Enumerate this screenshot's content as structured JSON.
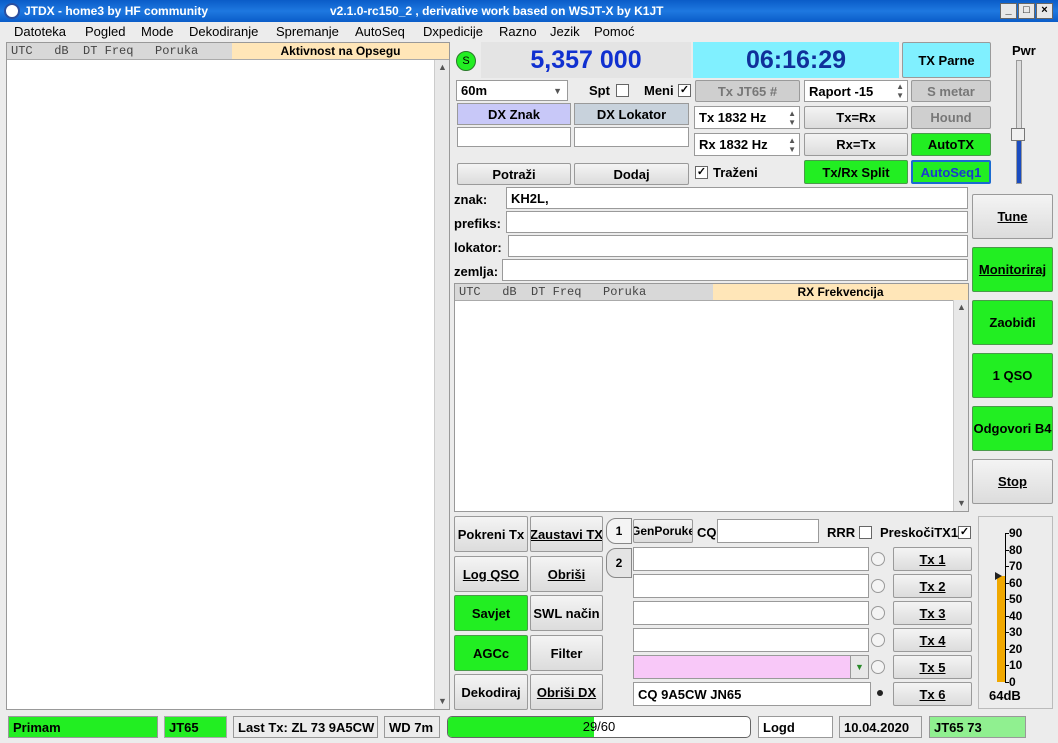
{
  "window": {
    "title_left": "JTDX - home3  by HF community",
    "title_right": "v2.1.0-rc150_2 , derivative work based on WSJT-X by K1JT",
    "min": "_",
    "max": "□",
    "close": "×"
  },
  "menu": [
    "Datoteka",
    "Pogled",
    "Mode",
    "Dekodiranje",
    "Spremanje",
    "AutoSeq",
    "Dxpedicije",
    "Razno",
    "Jezik",
    "Pomoć"
  ],
  "band_activity": {
    "header_cols": "UTC   dB  DT Freq   Poruka",
    "header_title": "Aktivnost na Opsegu"
  },
  "rx_frequency": {
    "header_cols": "UTC   dB  DT Freq   Poruka",
    "header_title": "RX Frekvencija"
  },
  "top": {
    "s_badge": "S",
    "frequency": "5,357 000",
    "clock": "06:16:29",
    "tx_parity": "TX Parne",
    "pwr_label": "Pwr",
    "band": "60m",
    "spt_label": "Spt",
    "meni_label": "Meni",
    "meni_checked": "✓",
    "tx_mode": "Tx JT65  #",
    "report": "Raport -15",
    "s_meter": "S metar",
    "dx_call_label": "DX Znak",
    "dx_grid_label": "DX Lokator",
    "tx_hz": "Tx  1832  Hz",
    "rx_hz": "Rx  1832  Hz",
    "tx_eq_rx": "Tx=Rx",
    "rx_eq_tx": "Rx=Tx",
    "hound": "Hound",
    "autotx": "AutoTX",
    "autoseq1": "AutoSeq1",
    "lookup": "Potraži",
    "add": "Dodaj",
    "wanted_label": "Traženi",
    "wanted_checked": "✓",
    "split": "Tx/Rx Split"
  },
  "info": {
    "call_label": "znak:",
    "call_value": "KH2L,",
    "prefix_label": "prefiks:",
    "prefix_value": "",
    "grid_label": "lokator:",
    "grid_value": "",
    "country_label": "zemlja:",
    "country_value": ""
  },
  "right_buttons": [
    "Tune",
    "Monitoriraj",
    "Zaobiđi",
    "1 QSO",
    "Odgovori B4",
    "Stop"
  ],
  "controls": {
    "start_tx": "Pokreni Tx",
    "stop_tx": "Zaustavi TX",
    "log_qso": "Log QSO",
    "erase": "Obriši",
    "hint": "Savjet",
    "swl": "SWL način",
    "agcc": "AGCc",
    "filter": "Filter",
    "decode": "Dekodiraj",
    "erase_dx": "Obriši DX"
  },
  "tabs": {
    "tab1": "1",
    "tab2": "2"
  },
  "tx_panel": {
    "gen_msgs": "GenPoruke",
    "cq_label": "CQ",
    "rrr_label": "RRR",
    "skip_tx1_label": "PreskočiTX1",
    "skip_tx1_checked": "✓",
    "tx_buttons": [
      "Tx 1",
      "Tx 2",
      "Tx 3",
      "Tx 4",
      "Tx 5",
      "Tx 6"
    ],
    "tx_messages": [
      "",
      "",
      "",
      "",
      "",
      ""
    ],
    "tx6_message": "CQ 9A5CW JN65"
  },
  "meter": {
    "ticks": [
      "90",
      "80",
      "70",
      "60",
      "50",
      "40",
      "30",
      "20",
      "10",
      "0"
    ],
    "level_db": 64,
    "level_text": "64dB"
  },
  "status": {
    "receiving": "Primam",
    "mode": "JT65",
    "last_tx": "Last Tx: ZL 73 9A5CW",
    "wd": "WD 7m",
    "progress_text": "29/60",
    "progress_value": 29,
    "progress_max": 60,
    "logd": "Logd",
    "date": "10.04.2020",
    "mode_status": "JT65  73"
  },
  "colors": {
    "green": "#22ee22",
    "freq_blue": "#1030d0",
    "clock_bg": "#80f0ff",
    "band_header": "#ffe6b8",
    "meter_fill": "#f0a800",
    "pink": "#f8c8f8"
  }
}
